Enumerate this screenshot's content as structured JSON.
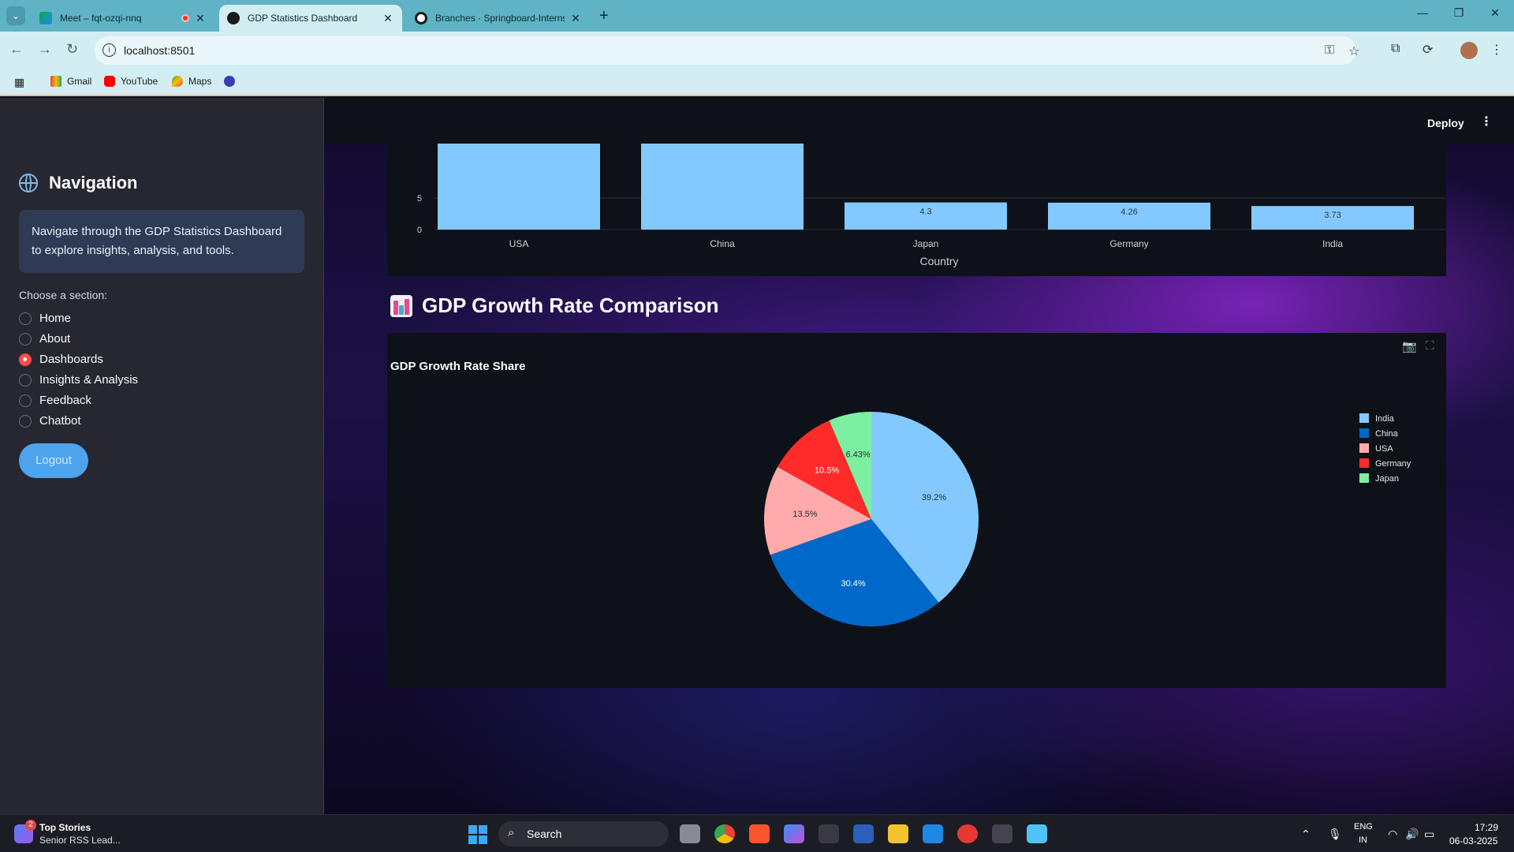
{
  "browser": {
    "tabs": [
      {
        "title": "Meet – fqt-ozqi-nnq",
        "active": false
      },
      {
        "title": "GDP Statistics Dashboard",
        "active": true
      },
      {
        "title": "Branches · Springboard-Interns",
        "active": false
      }
    ],
    "url": "localhost:8501",
    "bookmarks": [
      "Gmail",
      "YouTube",
      "Maps"
    ]
  },
  "sidebar": {
    "title": "Navigation",
    "info": "Navigate through the GDP Statistics Dashboard to explore insights, analysis, and tools.",
    "choose_label": "Choose a section:",
    "sections": [
      "Home",
      "About",
      "Dashboards",
      "Insights & Analysis",
      "Feedback",
      "Chatbot"
    ],
    "selected": "Dashboards",
    "logout_label": "Logout"
  },
  "header": {
    "deploy_label": "Deploy"
  },
  "main": {
    "section_title": "GDP Growth Rate Comparison"
  },
  "chart_data": [
    {
      "type": "bar",
      "categories": [
        "USA",
        "China",
        "Japan",
        "Germany",
        "India"
      ],
      "values": [
        null,
        null,
        4.3,
        4.26,
        3.73
      ],
      "data_labels": [
        "",
        "",
        "4.3",
        "4.26",
        "3.73"
      ],
      "xlabel": "Country",
      "y_ticks": [
        "0",
        "5"
      ],
      "color": "#83c9ff"
    },
    {
      "type": "pie",
      "title": "GDP Growth Rate Share",
      "labels": [
        "India",
        "China",
        "USA",
        "Germany",
        "Japan"
      ],
      "values": [
        39.2,
        30.4,
        13.5,
        10.5,
        6.43
      ],
      "text_labels": [
        "39.2%",
        "30.4%",
        "13.5%",
        "10.5%",
        "6.43%"
      ],
      "colors": [
        "#83c9ff",
        "#0068c9",
        "#ffabab",
        "#ff2b2b",
        "#7defa1"
      ],
      "legend": "right"
    }
  ],
  "taskbar": {
    "news_badge": "2",
    "news_title": "Top Stories",
    "news_subtitle": "Senior RSS Lead...",
    "search_label": "Search",
    "lang_top": "ENG",
    "lang_bottom": "IN",
    "time": "17:29",
    "date": "06-03-2025"
  }
}
